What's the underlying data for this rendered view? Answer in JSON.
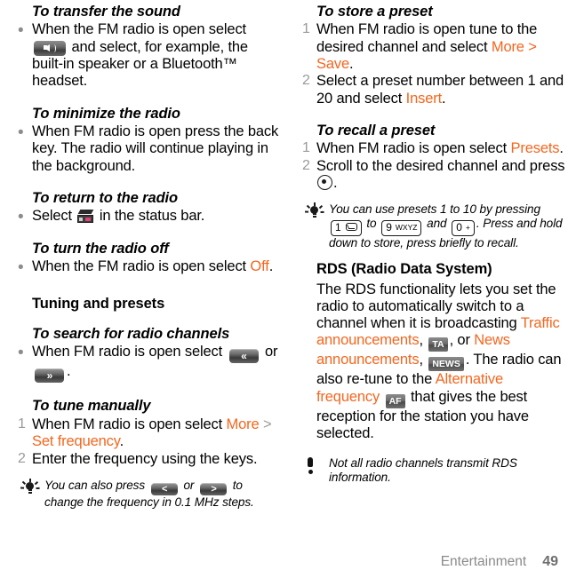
{
  "footer": {
    "chapter": "Entertainment",
    "page": "49"
  },
  "colors": {
    "accent": "#f4661f",
    "marker_gray": "#9a9a9a",
    "text": "#000000"
  },
  "left_column": {
    "sections": [
      {
        "heading": "To transfer the sound",
        "heading_style": "italic-bold",
        "items": [
          {
            "marker": "bullet",
            "text_before": "When the FM radio is open select",
            "icon": "speaker-button-icon",
            "text_after": "and select, for example, the built-in speaker or a Bluetooth™ headset."
          }
        ]
      },
      {
        "heading": "To minimize the radio",
        "heading_style": "italic-bold",
        "items": [
          {
            "marker": "bullet",
            "text": "When FM radio is open press the back key. The radio will continue playing in the background."
          }
        ]
      },
      {
        "heading": "To return to the radio",
        "heading_style": "italic-bold",
        "items": [
          {
            "marker": "bullet",
            "text_before": "Select",
            "icon": "radio-status-icon",
            "text_after": "in the status bar."
          }
        ]
      },
      {
        "heading": "To turn the radio off",
        "heading_style": "italic-bold",
        "items": [
          {
            "marker": "bullet",
            "text_before": "When the FM radio is open select",
            "accent": "Off",
            "text_after": "."
          }
        ]
      },
      {
        "heading": "Tuning and presets",
        "heading_style": "bold"
      },
      {
        "heading": "To search for radio channels",
        "heading_style": "italic-bold",
        "items": [
          {
            "marker": "bullet",
            "text_before": "When FM radio is open select",
            "icon_1": "rewind-button-icon",
            "icon_1_glyph": "«",
            "mid_text": "or",
            "icon_2": "fast-forward-button-icon",
            "icon_2_glyph": "»",
            "text_after": "."
          }
        ]
      },
      {
        "heading": "To tune manually",
        "heading_style": "italic-bold",
        "items": [
          {
            "marker": "1",
            "text_before": "When FM radio is open select",
            "accent_1": "More",
            "separator": ">",
            "accent_2": "Set frequency",
            "text_after": "."
          },
          {
            "marker": "2",
            "text": "Enter the frequency using the keys."
          }
        ]
      }
    ],
    "tip": {
      "icon": "lightbulb-tip-icon",
      "text_before": "You can also press",
      "icon_1": "left-arrow-button-icon",
      "icon_1_glyph": "<",
      "mid_text": "or",
      "icon_2": "right-arrow-button-icon",
      "icon_2_glyph": ">",
      "text_after": "to change the frequency in 0.1 MHz steps."
    }
  },
  "right_column": {
    "sections": [
      {
        "heading": "To store a preset",
        "heading_style": "italic-bold",
        "items": [
          {
            "marker": "1",
            "text_before": "When FM radio is open tune to the desired channel and select",
            "accent_1": "More",
            "separator": ">",
            "accent_2": "Save",
            "text_after": "."
          },
          {
            "marker": "2",
            "text_before": "Select a preset number between 1 and 20 and select",
            "accent": "Insert",
            "text_after": "."
          }
        ]
      },
      {
        "heading": "To recall a preset",
        "heading_style": "italic-bold",
        "items": [
          {
            "marker": "1",
            "text_before": "When FM radio is open select",
            "accent": "Presets",
            "text_after": "."
          },
          {
            "marker": "2",
            "text_before": "Scroll to the desired channel and press",
            "icon": "select-key-icon",
            "text_after": "."
          }
        ]
      }
    ],
    "tip": {
      "icon": "lightbulb-tip-icon",
      "text_before": "You can use presets 1 to 10 by pressing",
      "key_1_digit": "1",
      "key_1_sub": "envelope-icon",
      "mid_text": "to",
      "key_2_digit": "9",
      "key_2_sub": "WXYZ",
      "mid_text_2": "and",
      "key_3_digit": "0",
      "key_3_sub": "+",
      "text_after": ". Press and hold down to store, press briefly to recall."
    },
    "rds": {
      "heading": "RDS (Radio Data System)",
      "heading_style": "bold",
      "body_1": "The RDS functionality lets you set the radio to automatically switch to a channel when it is broadcasting",
      "accent_1": "Traffic announcements",
      "comma_1": ",",
      "tag_1": "TA",
      "mid_1": ", or",
      "accent_2": "News announcements",
      "comma_2": ",",
      "tag_2": "NEWS",
      "mid_2": ". The radio can also re-tune to the",
      "accent_3": "Alternative frequency",
      "tag_3": "AF",
      "mid_3": "that gives the best reception for the station you have selected."
    },
    "note": {
      "icon": "exclamation-note-icon",
      "text": "Not all radio channels transmit RDS information."
    }
  }
}
